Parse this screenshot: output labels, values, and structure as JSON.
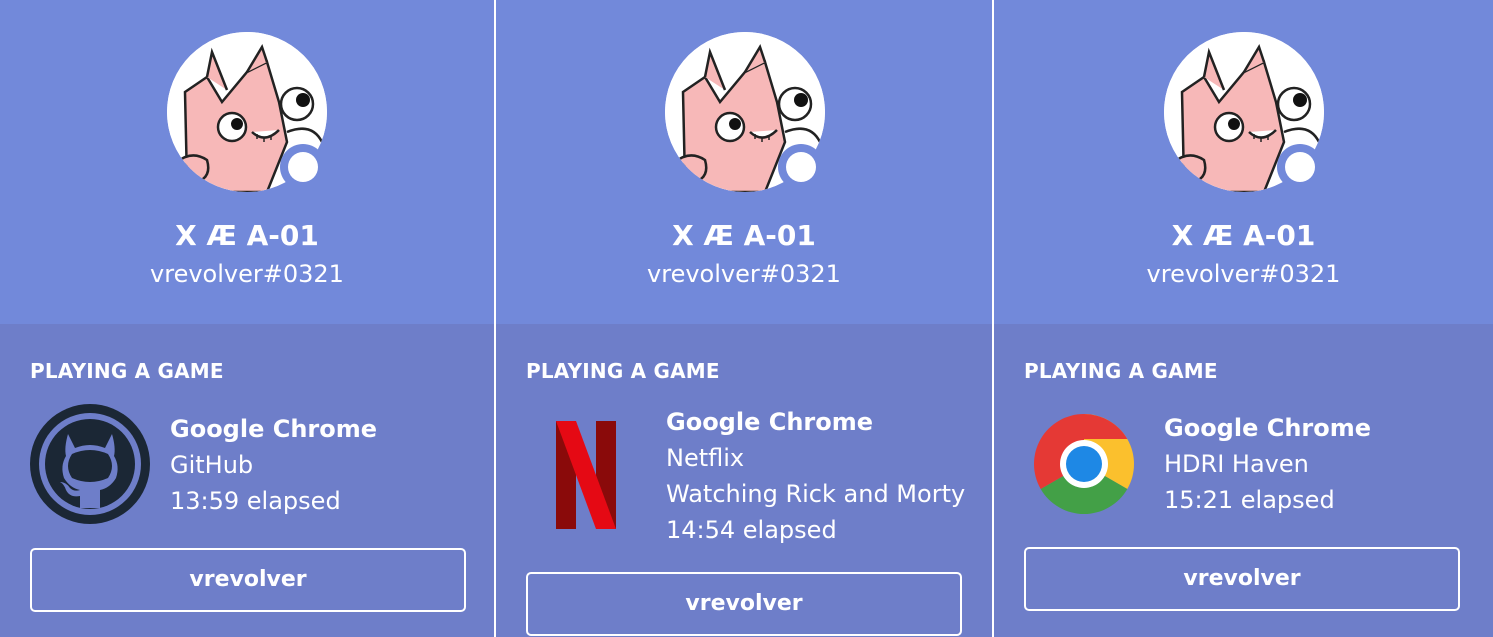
{
  "cards": [
    {
      "display_name": "X Æ A-01",
      "tag": "vrevolver#0321",
      "status": "online",
      "section_header": "PLAYING A GAME",
      "icon": "github-icon",
      "game_name": "Google Chrome",
      "details": "GitHub",
      "elapsed": "13:59 elapsed",
      "button_label": "vrevolver"
    },
    {
      "display_name": "X Æ A-01",
      "tag": "vrevolver#0321",
      "status": "online",
      "section_header": "PLAYING A GAME",
      "icon": "netflix-icon",
      "game_name": "Google Chrome",
      "details": "Netflix",
      "state": "Watching Rick and Morty",
      "elapsed": "14:54 elapsed",
      "button_label": "vrevolver"
    },
    {
      "display_name": "X Æ A-01",
      "tag": "vrevolver#0321",
      "status": "online",
      "section_header": "PLAYING A GAME",
      "icon": "chrome-icon",
      "game_name": "Google Chrome",
      "details": "HDRI Haven",
      "elapsed": "15:21 elapsed",
      "button_label": "vrevolver"
    }
  ],
  "colors": {
    "header_blurple": "#7289da",
    "body_blurple": "#6e7ec9",
    "text": "#ffffff"
  }
}
